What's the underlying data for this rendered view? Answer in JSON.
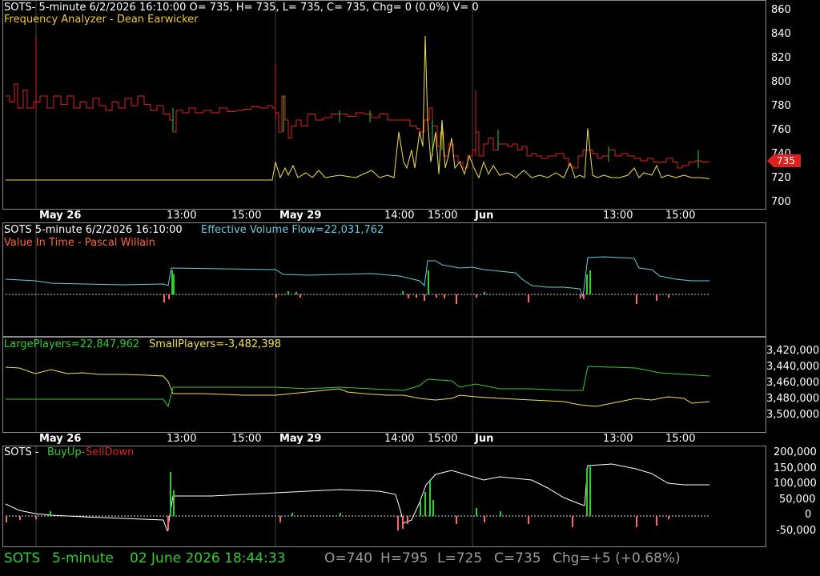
{
  "colors": {
    "up": "#33cc33",
    "down": "#e02020",
    "yellow": "#f2e050",
    "cyan": "#66ccdd",
    "white": "#ffffff",
    "orange": "#ff6633",
    "grid": "#444444"
  },
  "pane1": {
    "header": {
      "symbol_line": "SOTS- 5-minute 6/2/2026 16:10:00 O= 735, H= 735, L= 735, C= 735, Chg= 0 (0.0%) V= 0",
      "study_line": "Frequency Analyzer - Dean Earwicker"
    },
    "yaxis_ticks": [
      "860",
      "840",
      "820",
      "800",
      "780",
      "760",
      "740",
      "720",
      "700"
    ],
    "price_tag": "735"
  },
  "date_axis": {
    "labels": [
      {
        "text": "May 26",
        "bold": true
      },
      {
        "text": "13:00",
        "bold": false
      },
      {
        "text": "15:00",
        "bold": false
      },
      {
        "text": "May 29",
        "bold": true
      },
      {
        "text": "14:00",
        "bold": false
      },
      {
        "text": "15:00",
        "bold": false
      },
      {
        "text": "Jun",
        "bold": true
      },
      {
        "text": "13:00",
        "bold": false
      },
      {
        "text": "15:00",
        "bold": false
      }
    ]
  },
  "pane2": {
    "header_left": "SOTS 5-minute  6/2/2026 16:10:00",
    "header_right": "Effective Volume Flow=22,031,762",
    "study_line": "Value In Time - Pascal Willain"
  },
  "pane3": {
    "large": "LargePlayers=22,847,962",
    "small": "SmallPlayers=-3,482,398",
    "yaxis_ticks": [
      "3,420,000",
      "3,440,000",
      "3,460,000",
      "3,480,000",
      "3,500,000"
    ]
  },
  "pane4": {
    "symbol": "SOTS - ",
    "buy": "BuyUp-",
    "sell": "SellDown",
    "yaxis_ticks": [
      "200,000",
      "150,000",
      "100,000",
      "50,000",
      "0",
      "-50,000"
    ]
  },
  "status_bar": {
    "symbol": "SOTS",
    "interval": "5-minute",
    "datetime": "02 June 2026 18:44:33",
    "open": "O=740",
    "high": "H=795",
    "low": "L=725",
    "close": "C=735",
    "change": "Chg=+5 (+0.68%)"
  }
}
